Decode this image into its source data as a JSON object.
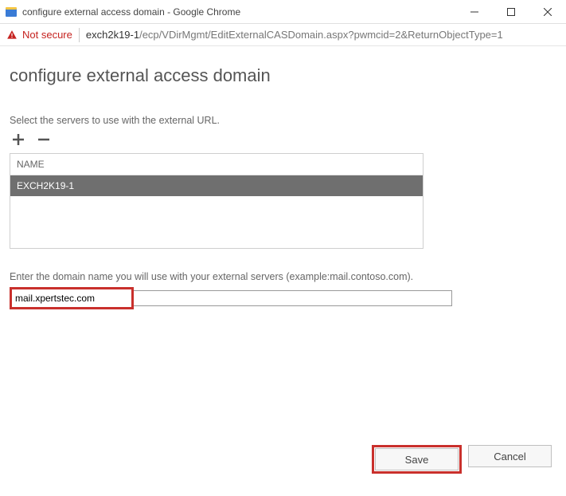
{
  "window": {
    "title": "configure external access domain - Google Chrome"
  },
  "addressbar": {
    "not_secure": "Not secure",
    "host": "exch2k19-1",
    "path": "/ecp/VDirMgmt/EditExternalCASDomain.aspx?pwmcid=2&ReturnObjectType=1"
  },
  "page": {
    "title": "configure external access domain",
    "servers_label": "Select the servers to use with the external URL.",
    "column_header": "NAME",
    "servers": [
      {
        "name": "EXCH2K19-1",
        "selected": true
      }
    ],
    "domain_label": "Enter the domain name you will use with your external servers (example:mail.contoso.com).",
    "domain_value": "mail.xpertstec.com"
  },
  "buttons": {
    "save": "Save",
    "cancel": "Cancel"
  },
  "icons": {
    "plus": "+",
    "minus": "−"
  }
}
